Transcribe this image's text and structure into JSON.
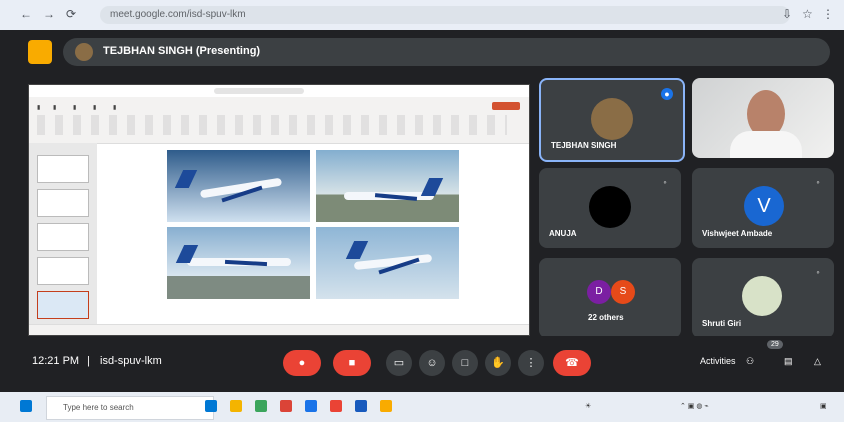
{
  "browser": {
    "url": "meet.google.com/isd-spuv-lkm"
  },
  "presenter": {
    "banner": "TEJBHAN SINGH (Presenting)"
  },
  "participants": [
    {
      "name": "TEJBHAN SINGH"
    },
    {
      "name": "ANUJA"
    },
    {
      "name": "Vishwjeet Ambade",
      "initial": "V"
    },
    {
      "name": "22 others",
      "initials": [
        "D",
        "S"
      ]
    },
    {
      "name": "Shruti Giri"
    }
  ],
  "controls": {
    "time": "12:21 PM",
    "separator": "|",
    "meeting_code": "isd-spuv-lkm",
    "right_text": "Activities",
    "badge": "29"
  },
  "taskbar": {
    "search_placeholder": "Type here to search"
  }
}
